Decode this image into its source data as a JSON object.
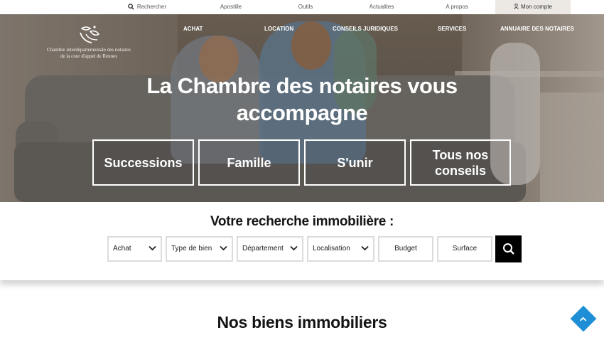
{
  "topbar": {
    "search_label": "Rechercher",
    "apostille_label": "Apostille",
    "outils_label": "Outils",
    "actualites_label": "Actualites",
    "apropos_label": "A propos",
    "account_label": "Mon compte"
  },
  "logo": {
    "line1": "Chambre interdépartementale des notaires",
    "line2": "de la cour d'appel de Rennes"
  },
  "main_nav": {
    "achat": "ACHAT",
    "location": "LOCATION",
    "conseils": "CONSEILS JURIDIQUES",
    "services": "SERVICES",
    "annuaire": "ANNUAIRE DES NOTAIRES"
  },
  "hero": {
    "title_line1": "La Chambre des notaires vous",
    "title_line2": "accompagne",
    "categories": [
      {
        "label": "Successions"
      },
      {
        "label": "Famille"
      },
      {
        "label": "S'unir"
      },
      {
        "label_line1": "Tous nos",
        "label_line2": "conseils"
      }
    ]
  },
  "search": {
    "title": "Votre recherche immobilière :",
    "fields": {
      "achat": "Achat",
      "type": "Type de bien",
      "departement": "Département",
      "localisation": "Localisation",
      "budget": "Budget",
      "surface": "Surface"
    }
  },
  "section": {
    "title": "Nos biens immobiliers"
  },
  "colors": {
    "accent_blue": "#1e8fd6",
    "search_button": "#000000",
    "text_dark": "#141414"
  },
  "icons": {
    "search": "search-icon",
    "account": "user-icon",
    "chevron": "chevron-down-icon",
    "back_to_top": "chevron-up-icon",
    "logo": "logo-icon"
  }
}
